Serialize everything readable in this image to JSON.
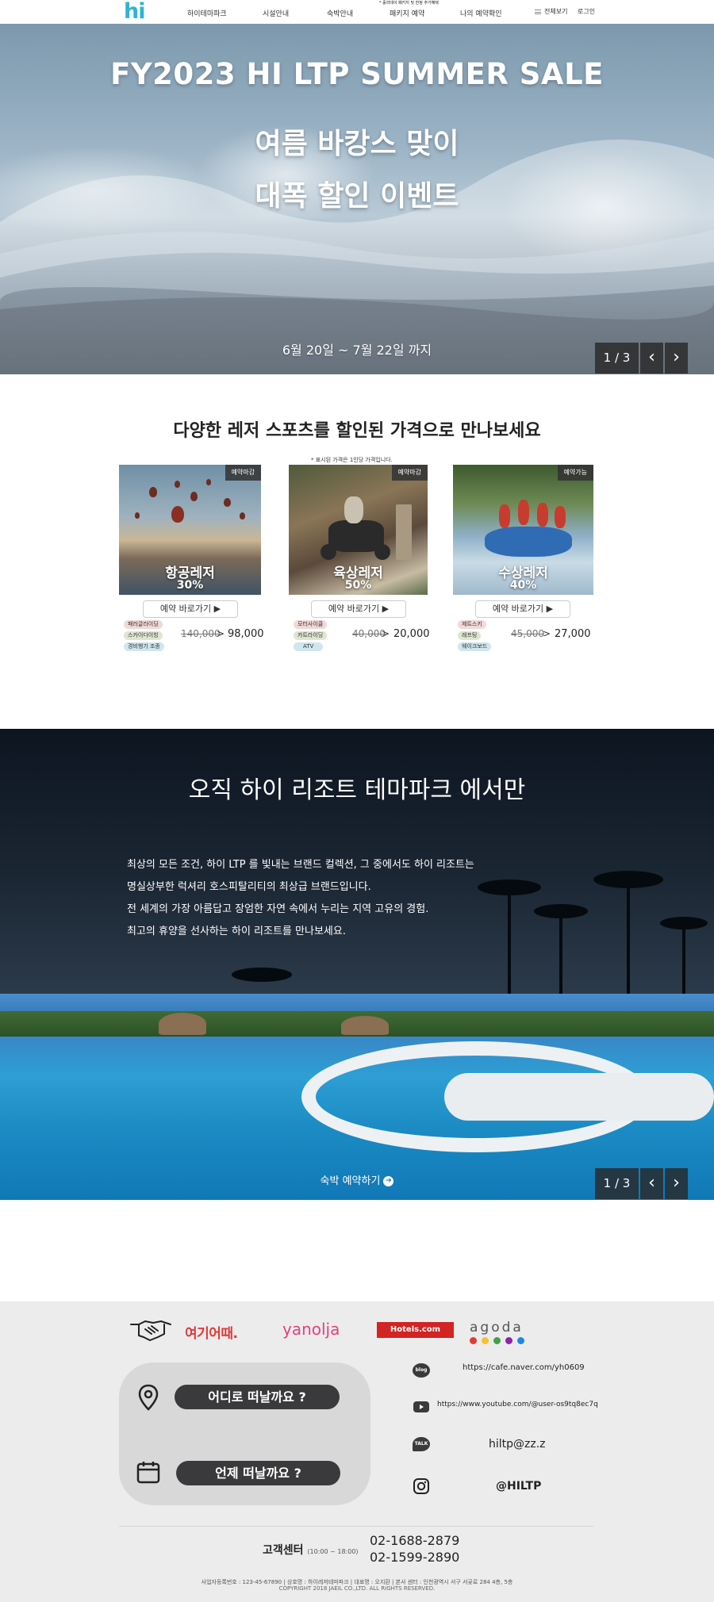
{
  "header": {
    "logo": "hi",
    "nav": [
      "하이테마파크",
      "시설안내",
      "숙박안내",
      "패키지 예약",
      "나의 예약확인"
    ],
    "nav_note": "* 홀리데이 패키지 및 한정 추가혜택",
    "all_view": "전체보기",
    "login": "로그인"
  },
  "hero": {
    "title": "FY2023 HI LTP SUMMER SALE",
    "line1": "여름 바캉스 맞이",
    "line2": "대폭 할인 이벤트",
    "date": "6월 20일 ~ 7월 22일 까지",
    "pager": "1 / 3",
    "prev": "‹",
    "next": "›"
  },
  "leisure": {
    "title": "다양한 레저 스포츠를 할인된 가격으로 만나보세요",
    "price_note": "* 표시된 가격은 1인당 가격입니다.",
    "cards": [
      {
        "badge": "예약마감",
        "title": "항공레저",
        "discount": "30%",
        "book": "예약 바로가기 ▶",
        "tags": [
          "패러글라이딩",
          "스카이다이빙",
          "경비행기 조종"
        ],
        "old_price": "140,000",
        "new_price": "98,000"
      },
      {
        "badge": "예약마감",
        "title": "육상레저",
        "discount": "50%",
        "book": "예약 바로가기 ▶",
        "tags": [
          "모터사이클",
          "카트라이딩",
          "ATV"
        ],
        "old_price": "40,000",
        "new_price": "20,000"
      },
      {
        "badge": "예약가능",
        "title": "수상레저",
        "discount": "40%",
        "book": "예약 바로가기 ▶",
        "tags": [
          "제트스키",
          "래프팅",
          "웨이크보드"
        ],
        "old_price": "45,000",
        "new_price": "27,000"
      }
    ],
    "arrow": ">"
  },
  "resort": {
    "title": "오직 하이 리조트 테마파크 에서만",
    "desc": [
      "최상의 모든 조건, 하이 LTP 를 빛내는 브랜드 컬렉션, 그 중에서도 하이 리조트는",
      "명실상부한 럭셔리 호스피탈리티의 최상급 브랜드입니다.",
      "전 세계의 가장 아름답고 장엄한 자연 속에서 누리는 지역 고유의 경험.",
      "최고의 휴양을 선사하는 하이 리조트를 만나보세요."
    ],
    "book_link": "숙박 예약하기",
    "pager": "1 / 3",
    "prev": "‹",
    "next": "›"
  },
  "footer": {
    "partners": [
      "여기어때.",
      "yanolja",
      "Hotels.com",
      "agoda"
    ],
    "where": "어디로 떠날까요 ?",
    "when": "언제 떠날까요 ?",
    "blog_icon": "blog",
    "talk_icon": "TALK",
    "blog_url": "https://cafe.naver.com/yh0609",
    "youtube_url": "https://www.youtube.com/@user-os9tq8ec7q",
    "email": "hiltp@zz.z",
    "instagram": "@HILTP",
    "cs_label": "고객센터",
    "cs_hours": "(10:00 ~ 18:00)",
    "phone1": "02-1688-2879",
    "phone2": "02-1599-2890",
    "company": "사업자등록번호 : 123-45-67890  |  상호명 : 하이레저테마파크  |  대표명 : 오지환  |  본사 센터 : 인천광역시 서구 서곶로 284 4층, 5층",
    "copyright": "COPYRIGHT 2018 JAEIL CO.,LTD. ALL RIGHTS RESERVED."
  },
  "colors": {
    "accent": "#2eb3d6",
    "dark_pill": "#3a3a3c",
    "footer_bg": "#ececec"
  }
}
